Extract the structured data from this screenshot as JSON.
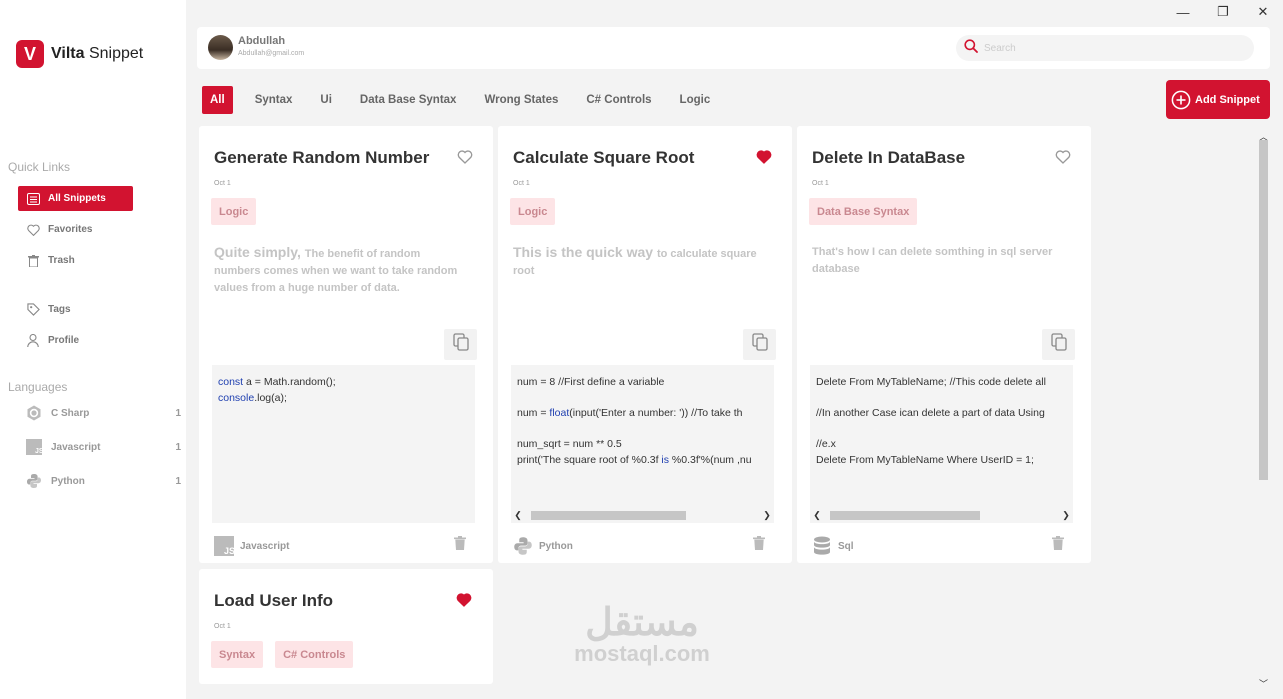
{
  "window": {
    "minimize": "—",
    "maximize": "❐",
    "close": "✕"
  },
  "app": {
    "logo_letter": "V",
    "name_bold": "Vilta",
    "name_rest": " Snippet",
    "accent": "#d21330"
  },
  "sidebar": {
    "quick_links_title": "Quick Links",
    "items": [
      {
        "label": "All Snippets",
        "icon": "list-icon",
        "active": true
      },
      {
        "label": "Favorites",
        "icon": "heart-icon"
      },
      {
        "label": "Trash",
        "icon": "trash-icon"
      },
      {
        "label": "Tags",
        "icon": "tag-icon"
      },
      {
        "label": "Profile",
        "icon": "user-icon"
      }
    ],
    "languages_title": "Languages",
    "languages": [
      {
        "label": "C Sharp",
        "count": "1",
        "icon": "csharp-icon"
      },
      {
        "label": "Javascript",
        "count": "1",
        "icon": "javascript-icon"
      },
      {
        "label": "Python",
        "count": "1",
        "icon": "python-icon"
      }
    ]
  },
  "header": {
    "user_name": "Abdullah",
    "user_email": "Abdullah@gmail.com",
    "search_placeholder": "Search"
  },
  "filters": {
    "tabs": [
      "All",
      "Syntax",
      "Ui",
      "Data Base Syntax",
      "Wrong States",
      "C# Controls",
      "Logic"
    ],
    "active": "All"
  },
  "add_button_label": "Add Snippet",
  "cards": [
    {
      "title": "Generate Random Number",
      "favorite": false,
      "date": "Oct 1",
      "tags": [
        "Logic"
      ],
      "desc_lead": "Quite simply, ",
      "desc_rest": "The benefit of random numbers comes when we want to take random values from a huge number of data.",
      "code": [
        "const a = Math.random();",
        "console.log(a);"
      ],
      "language": "Javascript"
    },
    {
      "title": "Calculate Square Root",
      "favorite": true,
      "date": "Oct 1",
      "tags": [
        "Logic"
      ],
      "desc_lead": "This is the quick way ",
      "desc_rest": "to calculate square root",
      "code": [
        "num = 8 //First define a variable",
        "",
        "num = float(input('Enter a number: ')) //To take th",
        "",
        "num_sqrt = num ** 0.5",
        "print('The square root of %0.3f is %0.3f'%(num ,nu"
      ],
      "language": "Python"
    },
    {
      "title": "Delete In DataBase",
      "favorite": false,
      "date": "Oct 1",
      "tags": [
        "Data Base Syntax"
      ],
      "desc_lead": "",
      "desc_rest": "That's how I can delete somthing in sql server database",
      "code": [
        "Delete From MyTableName; //This code delete all",
        "",
        "//In another Case ican delete a part of data Using",
        "",
        "//e.x",
        "Delete From MyTableName Where UserID = 1;"
      ],
      "language": "Sql"
    },
    {
      "title": "Load User Info",
      "favorite": true,
      "date": "Oct 1",
      "tags": [
        "Syntax",
        "C# Controls"
      ]
    }
  ],
  "watermark": {
    "arabic": "مستقل",
    "latin": "mostaql.com"
  }
}
